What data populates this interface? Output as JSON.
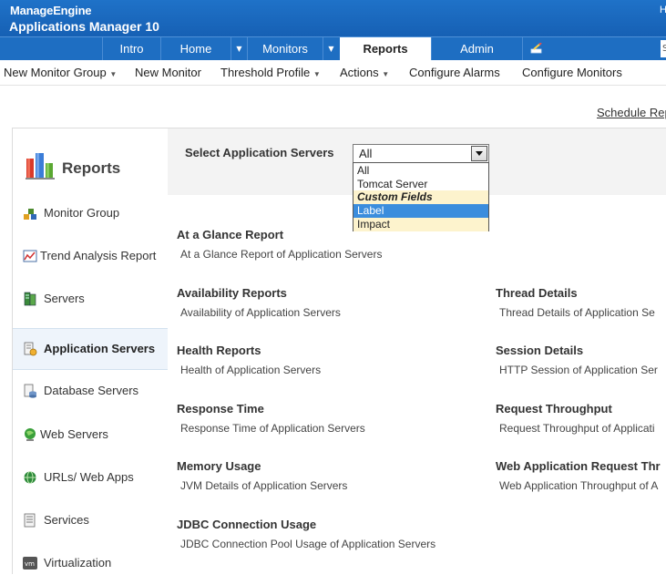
{
  "header": {
    "brand": "ManageEngine",
    "product": "Applications Manager 10",
    "right_text": "H"
  },
  "main_nav": {
    "items": [
      {
        "label": "Intro",
        "active": false,
        "dropdown": false
      },
      {
        "label": "Home",
        "active": false,
        "dropdown": true
      },
      {
        "label": "Monitors",
        "active": false,
        "dropdown": true
      },
      {
        "label": "Reports",
        "active": true,
        "dropdown": false
      },
      {
        "label": "Admin",
        "active": false,
        "dropdown": false
      }
    ],
    "dropdown_arrow": "▼",
    "extra_icon": "pen-icon",
    "search_partial": "S"
  },
  "sub_nav": {
    "items": [
      {
        "label": "New Monitor Group",
        "caret": true
      },
      {
        "label": "New Monitor",
        "caret": false
      },
      {
        "label": "Threshold Profile",
        "caret": true
      },
      {
        "label": "Actions",
        "caret": true
      },
      {
        "label": "Configure Alarms",
        "caret": false
      },
      {
        "label": "Configure Monitors",
        "caret": false
      }
    ],
    "caret_glyph": "▼"
  },
  "schedule_link": "Schedule Rep",
  "sidebar": {
    "title": "Reports",
    "items": [
      {
        "label": "Monitor Group",
        "icon": "monitor-group-icon",
        "active": false
      },
      {
        "label": "Trend Analysis Report",
        "icon": "trend-chart-icon",
        "active": false
      },
      {
        "label": "Servers",
        "icon": "server-icon",
        "active": false
      },
      {
        "label": "Application Servers",
        "icon": "application-server-icon",
        "active": true
      },
      {
        "label": "Database Servers",
        "icon": "database-icon",
        "active": false
      },
      {
        "label": "Web Servers",
        "icon": "globe-icon",
        "active": false
      },
      {
        "label": "URLs/ Web Apps",
        "icon": "web-app-icon",
        "active": false
      },
      {
        "label": "Services",
        "icon": "services-icon",
        "active": false
      },
      {
        "label": "Virtualization",
        "icon": "vm-icon",
        "active": false
      }
    ]
  },
  "selector": {
    "label": "Select Application Servers",
    "value": "All",
    "options": [
      {
        "label": "All",
        "type": "option"
      },
      {
        "label": "Tomcat Server",
        "type": "option"
      },
      {
        "label": "Custom Fields",
        "type": "group"
      },
      {
        "label": "Label",
        "type": "selected"
      },
      {
        "label": "Impact",
        "type": "option"
      }
    ]
  },
  "reports_left": [
    {
      "title": "At a Glance Report",
      "desc": "At a Glance Report of Application Servers"
    },
    {
      "title": "Availability Reports",
      "desc": "Availability of Application Servers"
    },
    {
      "title": "Health Reports",
      "desc": "Health of Application Servers"
    },
    {
      "title": "Response Time",
      "desc": "Response Time of Application Servers"
    },
    {
      "title": "Memory Usage",
      "desc": "JVM Details of Application Servers"
    },
    {
      "title": "JDBC Connection Usage",
      "desc": "JDBC Connection Pool Usage of Application Servers"
    }
  ],
  "reports_right": [
    {
      "title": "Thread Details",
      "desc": "Thread Details of Application Se"
    },
    {
      "title": "Session Details",
      "desc": "HTTP Session of Application Ser"
    },
    {
      "title": "Request Throughput",
      "desc": "Request Throughput of Applicati"
    },
    {
      "title": "Web Application Request Thr",
      "desc": "Web Application Throughput of A"
    }
  ],
  "colors": {
    "header_blue": "#1f72c8",
    "active_sidebar_bg": "#eef4fb",
    "dropdown_highlight": "#3b8ddd",
    "dropdown_group_bg": "#fdf3cd"
  }
}
